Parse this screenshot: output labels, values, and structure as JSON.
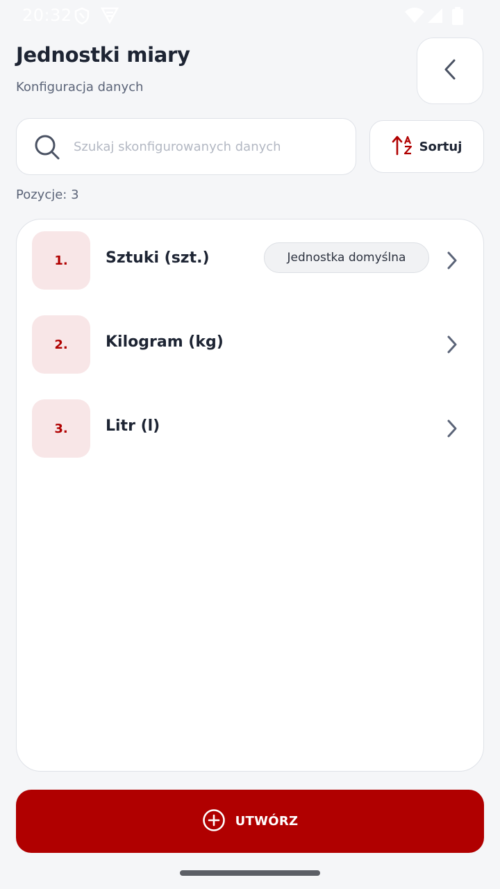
{
  "status_bar": {
    "time": "20:32"
  },
  "header": {
    "title": "Jednostki miary",
    "subtitle": "Konfiguracja danych"
  },
  "search": {
    "placeholder": "Szukaj skonfigurowanych danych",
    "value": ""
  },
  "sort": {
    "label": "Sortuj"
  },
  "count_label": "Pozycje: 3",
  "items": [
    {
      "number": "1.",
      "name": "Sztuki (szt.)",
      "badge": "Jednostka domyślna"
    },
    {
      "number": "2.",
      "name": "Kilogram (kg)"
    },
    {
      "number": "3.",
      "name": "Litr (l)"
    }
  ],
  "create_button": {
    "label": "UTWÓRZ"
  },
  "colors": {
    "accent": "#b00000",
    "accent_light": "#f8e6e7",
    "background": "#f5f6f8"
  },
  "icons": [
    "shield-icon",
    "vpn-icon",
    "wifi-icon",
    "signal-icon",
    "battery-icon",
    "back-arrow-icon",
    "search-icon",
    "sort-az-icon",
    "chevron-right-icon",
    "plus-circle-icon"
  ]
}
